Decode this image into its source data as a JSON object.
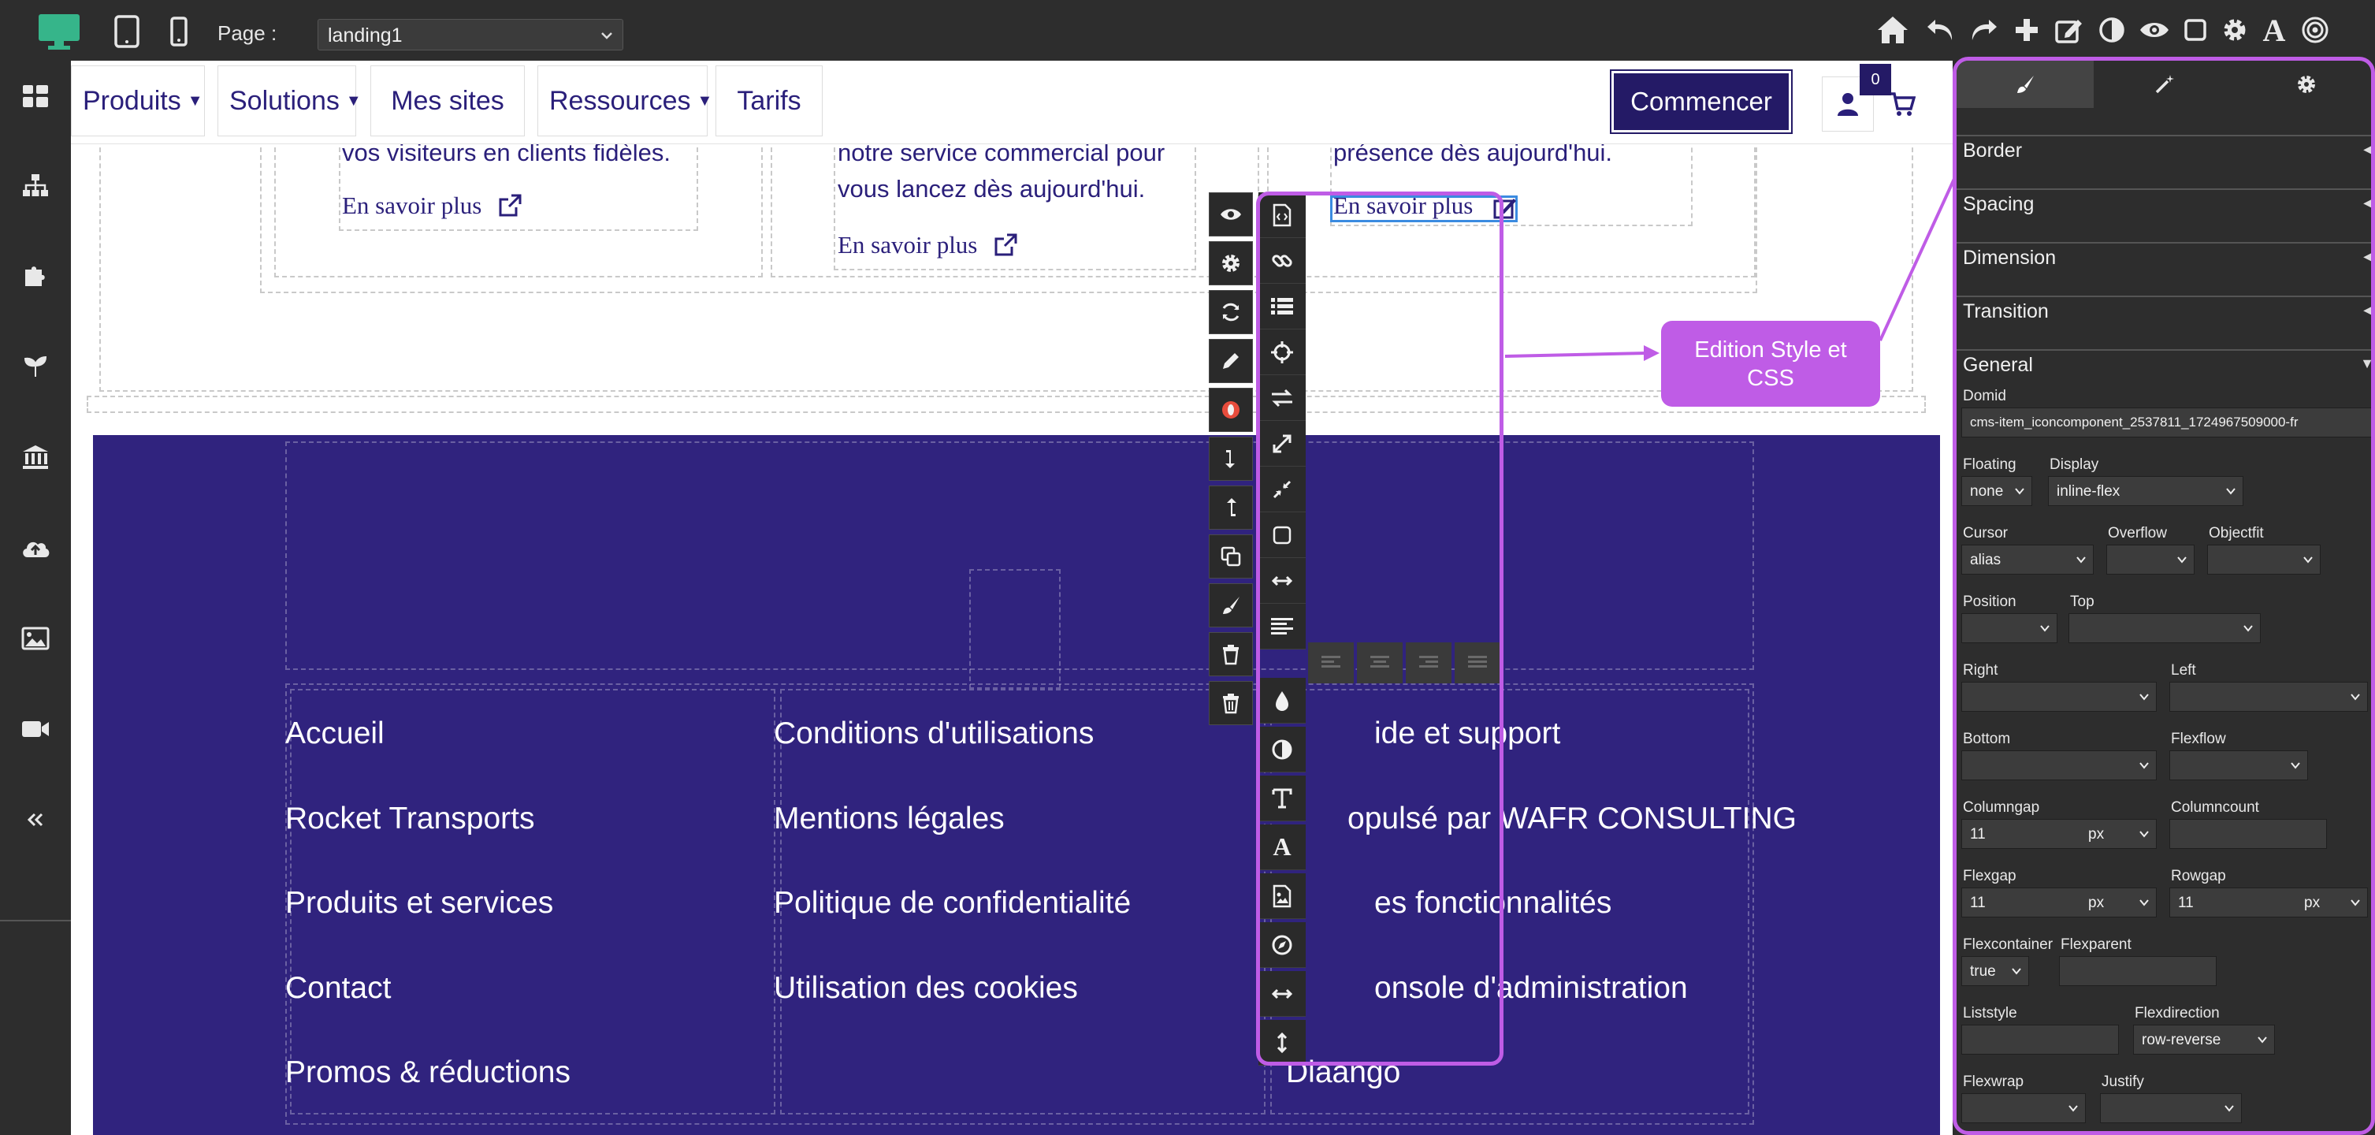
{
  "topbar": {
    "page_label": "Page :",
    "page_value": "landing1",
    "device_icons": [
      "desktop-icon",
      "tablet-icon",
      "phone-icon"
    ],
    "tool_icons": [
      "home-icon",
      "undo-icon",
      "redo-icon",
      "add-icon",
      "edit-icon",
      "contrast-icon",
      "preview-icon",
      "square-icon",
      "settings-icon",
      "font-icon",
      "target-icon"
    ]
  },
  "sidebar": {
    "items": [
      "dashboard-icon",
      "sitemap-icon",
      "plugin-icon",
      "seedling-icon",
      "bank-icon",
      "cloud-upload-icon",
      "image-icon",
      "video-icon",
      "collapse-icon"
    ]
  },
  "site": {
    "nav": [
      {
        "label": "Produits",
        "dropdown": true
      },
      {
        "label": "Solutions",
        "dropdown": true
      },
      {
        "label": "Mes sites",
        "dropdown": false
      },
      {
        "label": "Ressources",
        "dropdown": true
      },
      {
        "label": "Tarifs",
        "dropdown": false
      }
    ],
    "cta": "Commencer",
    "cart_count": "0",
    "cards": [
      {
        "text": "vos visiteurs en clients fidèles.",
        "link": "En savoir plus"
      },
      {
        "text1": "notre service commercial pour",
        "text2": "vous lancez dès aujourd'hui.",
        "link": "En savoir plus"
      },
      {
        "text": "présence dès aujourd'hui.",
        "link": "En savoir plus"
      }
    ],
    "footer": {
      "col1": [
        "Accueil",
        "Rocket Transports",
        "Produits et services",
        "Contact",
        "Promos & réductions"
      ],
      "col2": [
        "Conditions d'utilisations",
        "Mentions légales",
        "Politique de confidentialité",
        "Utilisation des cookies"
      ],
      "col3": [
        "ide et support",
        "opulsé par WAFR CONSULTING",
        "es fonctionnalités",
        "onsole d'administration",
        "Diaango"
      ]
    }
  },
  "toolbar": {
    "col1": [
      "eye-icon",
      "gear-icon",
      "refresh-icon",
      "pencil-icon",
      "opera-icon",
      "arrow-down-icon",
      "arrow-up-icon",
      "clone-icon",
      "brush-icon",
      "trash-icon",
      "trash-alt-icon"
    ],
    "col2": [
      "code-file-icon",
      "link-icon",
      "list-icon",
      "crosshair-icon",
      "swap-icon",
      "expand-icon",
      "compress-icon",
      "square-outline-icon",
      "width-icon",
      "align-left-icon",
      "droplet-icon",
      "contrast-half-icon",
      "text-type-icon",
      "font-a-icon",
      "image-file-icon",
      "compass-icon",
      "horizontal-arrows-icon",
      "vertical-arrows-icon"
    ],
    "align": [
      "align-left",
      "align-center",
      "align-right",
      "align-justify"
    ]
  },
  "callout": {
    "text": "Edition Style et CSS"
  },
  "accent_color": "#bf5ce6",
  "brand_color": "#2a1f7a",
  "panel": {
    "tabs": [
      "brush-tab-icon",
      "magic-wand-tab-icon",
      "gear-tab-icon"
    ],
    "sections": [
      "Border",
      "Spacing",
      "Dimension",
      "Transition",
      "General"
    ],
    "domid_label": "Domid",
    "domid_value": "cms-item_iconcomponent_2537811_1724967509000-fr",
    "floating_label": "Floating",
    "floating_value": "none",
    "display_label": "Display",
    "display_value": "inline-flex",
    "cursor_label": "Cursor",
    "cursor_value": "alias",
    "overflow_label": "Overflow",
    "overflow_value": "",
    "objectfit_label": "Objectfit",
    "objectfit_value": "",
    "position_label": "Position",
    "position_value": "",
    "top_label": "Top",
    "top_value": "",
    "right_label": "Right",
    "right_value": "",
    "left_label": "Left",
    "left_value": "",
    "bottom_label": "Bottom",
    "bottom_value": "",
    "flexflow_label": "Flexflow",
    "flexflow_value": "",
    "columngap_label": "Columngap",
    "columngap_value": "11",
    "columngap_unit": "px",
    "columncount_label": "Columncount",
    "columncount_value": "",
    "flexgap_label": "Flexgap",
    "flexgap_value": "11",
    "flexgap_unit": "px",
    "rowgap_label": "Rowgap",
    "rowgap_value": "11",
    "rowgap_unit": "px",
    "flexcontainer_label": "Flexcontainer",
    "flexcontainer_value": "true",
    "flexparent_label": "Flexparent",
    "flexparent_value": "",
    "liststyle_label": "Liststyle",
    "liststyle_value": "",
    "flexdirection_label": "Flexdirection",
    "flexdirection_value": "row-reverse",
    "flexwrap_label": "Flexwrap",
    "flexwrap_value": "",
    "justify_label": "Justify",
    "justify_value": ""
  }
}
